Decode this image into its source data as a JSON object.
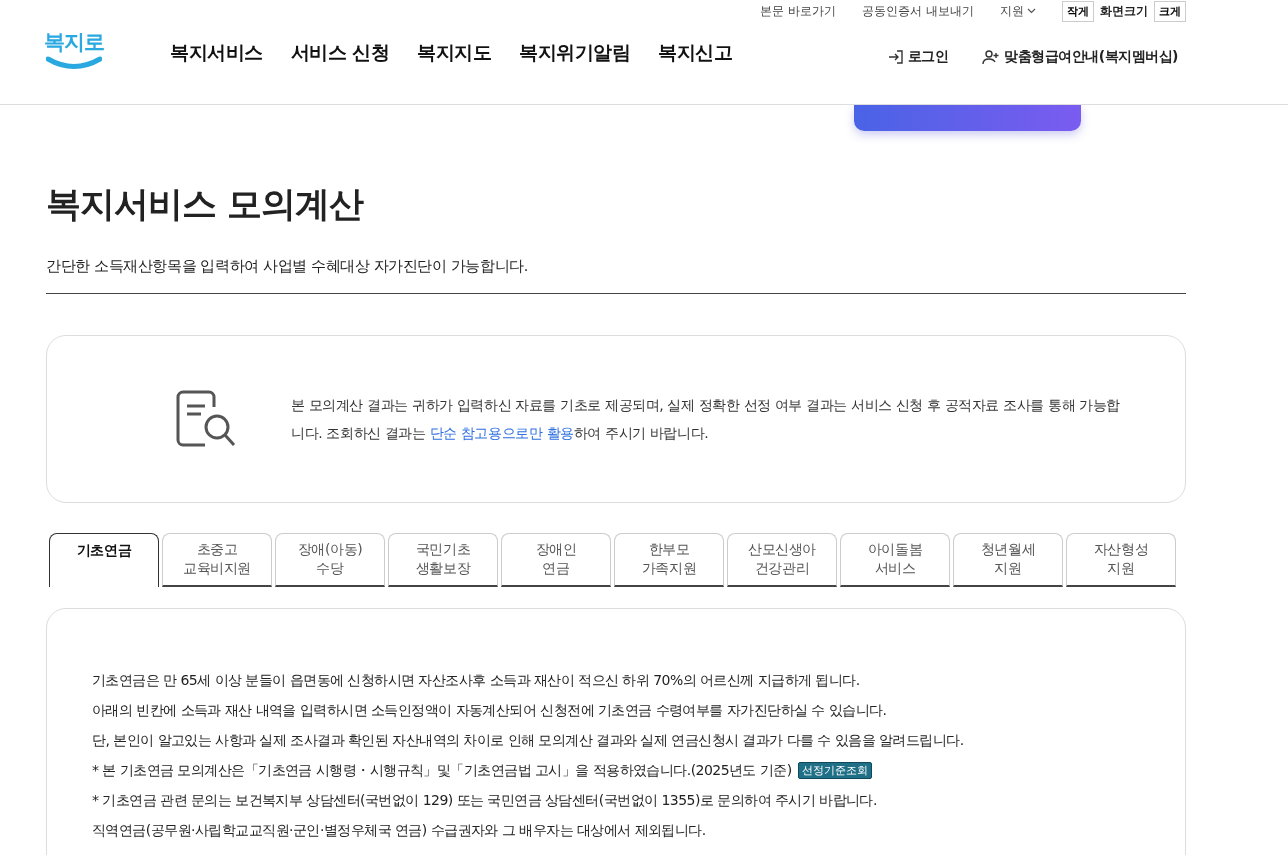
{
  "utility_links": [
    {
      "label": "본문 바로가기"
    },
    {
      "label": "공동인증서 내보내기"
    },
    {
      "label": "지원",
      "kind": "dropdown"
    }
  ],
  "font_size": {
    "label": "화면크기",
    "smaller": "작게",
    "larger": "크게"
  },
  "logo": {
    "text": "복지로"
  },
  "nav": [
    "복지서비스",
    "서비스 신청",
    "복지지도",
    "복지위기알림",
    "복지신고"
  ],
  "account": {
    "login": "로그인",
    "membership": "맞춤형급여안내(복지멤버십)"
  },
  "page": {
    "title": "복지서비스 모의계산",
    "subtitle": "간단한 소득재산항목을 입력하여 사업별 수혜대상 자가진단이 가능합니다."
  },
  "notice": {
    "before": "본 모의계산 결과는 귀하가 입력하신 자료를 기초로 제공되며, 실제 정확한 선정 여부 결과는 서비스 신청 후 공적자료 조사를 통해 가능합니다. 조회하신 결과는 ",
    "link": "단순 참고용으로만 활용",
    "after": "하여 주시기 바랍니다."
  },
  "tabs": [
    {
      "lines": [
        "기초연금"
      ],
      "selected": true
    },
    {
      "lines": [
        "초중고",
        "교육비지원"
      ],
      "selected": false
    },
    {
      "lines": [
        "장애(아동)",
        "수당"
      ],
      "selected": false
    },
    {
      "lines": [
        "국민기초",
        "생활보장"
      ],
      "selected": false
    },
    {
      "lines": [
        "장애인",
        "연금"
      ],
      "selected": false
    },
    {
      "lines": [
        "한부모",
        "가족지원"
      ],
      "selected": false
    },
    {
      "lines": [
        "산모신생아",
        "건강관리"
      ],
      "selected": false
    },
    {
      "lines": [
        "아이돌봄",
        "서비스"
      ],
      "selected": false
    },
    {
      "lines": [
        "청년월세",
        "지원"
      ],
      "selected": false
    },
    {
      "lines": [
        "자산형성",
        "지원"
      ],
      "selected": false
    }
  ],
  "content": [
    {
      "text": "기초연금은 만 65세 이상 분들이 읍면동에 신청하시면 자산조사후 소득과 재산이 적으신 하위 70%의 어르신께 지급하게 됩니다."
    },
    {
      "text": "아래의 빈칸에 소득과 재산 내역을 입력하시면 소득인정액이 자동계산되어 신청전에 기초연금 수령여부를 자가진단하실 수 있습니다."
    },
    {
      "text": "단, 본인이 알고있는 사항과 실제 조사결과 확인된 자산내역의 차이로 인해 모의계산 결과와 실제 연금신청시 결과가 다를 수 있음을 알려드립니다."
    },
    {
      "text": "* 본 기초연금 모의계산은「기초연금 시행령・시행규칙」및「기초연금법 고시」을 적용하였습니다.(2025년도 기준)",
      "button": "선정기준조회"
    },
    {
      "text": "* 기초연금 관련 문의는 보건복지부 상담센터(국번없이 129) 또는 국민연금 상담센터(국번없이 1355)로 문의하여 주시기 바랍니다."
    },
    {
      "text": "직역연금(공무원·사립학교교직원·군인·별정우체국 연금) 수급권자와 그 배우자는 대상에서 제외됩니다."
    }
  ]
}
